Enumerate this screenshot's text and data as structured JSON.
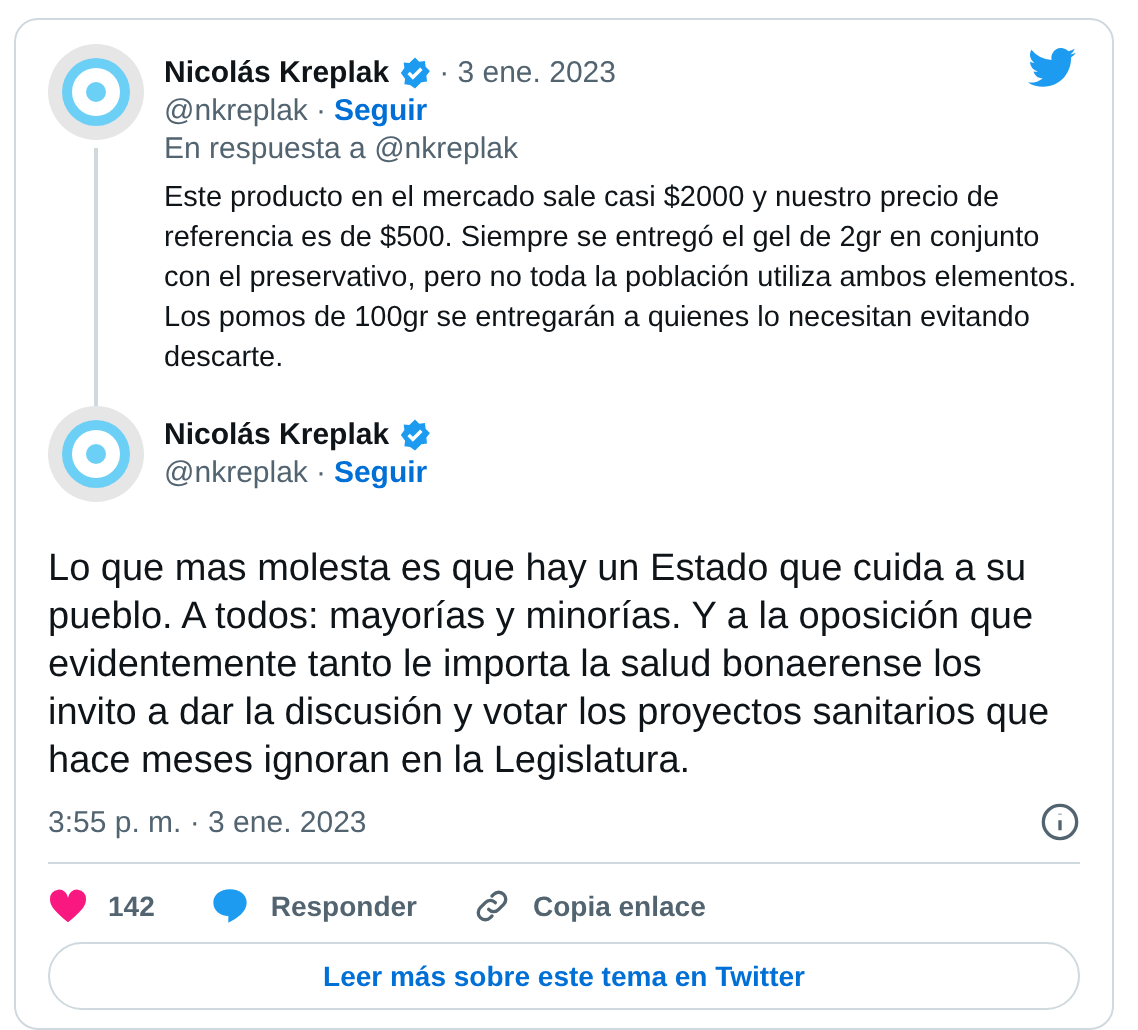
{
  "quoted_tweet": {
    "author": "Nicolás Kreplak",
    "verified": true,
    "date": "· 3 ene. 2023",
    "handle": "@nkreplak",
    "separator": "·",
    "follow": "Seguir",
    "reply_to": "En respuesta a @nkreplak",
    "text": "Este producto en el mercado sale casi $2000 y nuestro precio de referencia es de $500. Siempre se entregó el gel de 2gr en conjunto con el preservativo, pero no toda la población utiliza ambos elementos. Los pomos de 100gr se entregarán a quienes lo necesitan evitando descarte."
  },
  "main_tweet": {
    "author": "Nicolás Kreplak",
    "verified": true,
    "handle": "@nkreplak",
    "separator": "·",
    "follow": "Seguir",
    "text": "Lo que mas molesta es que hay un Estado que cuida a su pueblo. A todos: mayorías y minorías. Y a la oposición que evidentemente tanto le importa la salud bonaerense los invito a dar la discusión y votar los proyectos sanitarios que hace meses ignoran en la Legislatura.",
    "timestamp": "3:55 p. m. · 3 ene. 2023"
  },
  "actions": [
    {
      "kind": "like",
      "label": "142"
    },
    {
      "kind": "reply",
      "label": "Responder"
    },
    {
      "kind": "copy",
      "label": "Copia enlace"
    }
  ],
  "read_more": "Leer más sobre este tema en Twitter"
}
